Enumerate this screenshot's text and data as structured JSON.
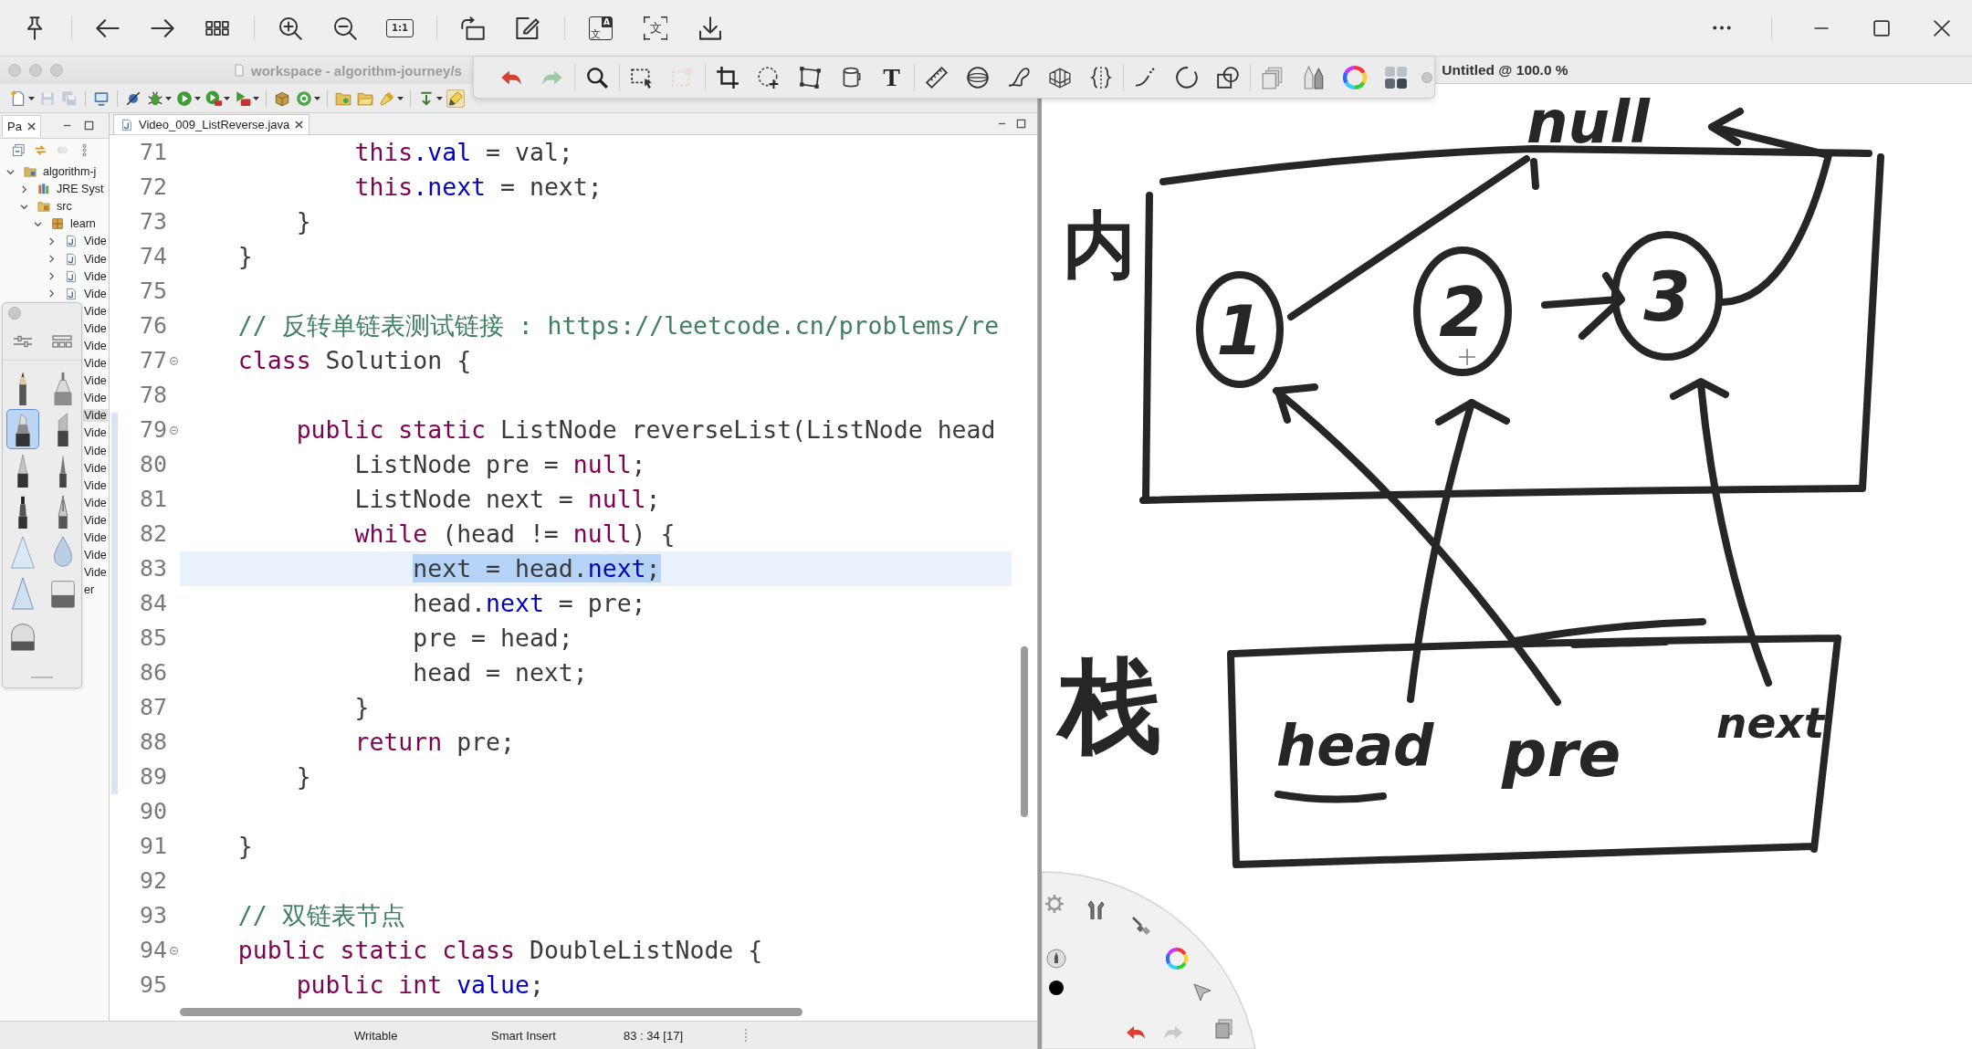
{
  "viewer": {
    "toolbar": [
      [
        {
          "kind": "pin"
        }
      ],
      [
        {
          "kind": "back"
        },
        {
          "kind": "forward"
        },
        {
          "kind": "thumbnails"
        }
      ],
      [
        {
          "kind": "zoom-in"
        },
        {
          "kind": "zoom-out"
        },
        {
          "kind": "actual-size",
          "label": "1:1"
        }
      ],
      [
        {
          "kind": "rotate"
        },
        {
          "kind": "edit"
        }
      ],
      [
        {
          "kind": "translate",
          "label": "文",
          "sublabel": "A"
        },
        {
          "kind": "ocr",
          "label": "文"
        },
        {
          "kind": "download"
        }
      ]
    ],
    "window_controls": [
      [
        {
          "kind": "more"
        }
      ],
      [
        {
          "kind": "minimize"
        },
        {
          "kind": "maximize"
        },
        {
          "kind": "close"
        }
      ]
    ]
  },
  "eclipse": {
    "title": "workspace - algorithm-journey/s",
    "toolbar": [
      [
        {
          "kind": "new",
          "dropdown": true,
          "disabled": false,
          "pressed": false
        },
        {
          "kind": "save",
          "dropdown": false,
          "disabled": true,
          "pressed": false
        },
        {
          "kind": "save-all",
          "dropdown": false,
          "disabled": true,
          "pressed": false
        }
      ],
      [
        {
          "kind": "console",
          "dropdown": false,
          "disabled": false,
          "pressed": false
        }
      ],
      [
        {
          "kind": "skip-breakpoints",
          "dropdown": false,
          "disabled": false,
          "pressed": false
        },
        {
          "kind": "debug",
          "dropdown": true,
          "disabled": false,
          "pressed": false
        },
        {
          "kind": "run",
          "dropdown": true,
          "disabled": false,
          "pressed": false
        },
        {
          "kind": "coverage",
          "dropdown": true,
          "disabled": false,
          "pressed": false
        },
        {
          "kind": "external-tools",
          "dropdown": true,
          "disabled": false,
          "pressed": false
        }
      ],
      [
        {
          "kind": "new-package",
          "dropdown": false,
          "disabled": false,
          "pressed": false
        },
        {
          "kind": "new-class",
          "dropdown": true,
          "disabled": false,
          "pressed": false
        }
      ],
      [
        {
          "kind": "open-type",
          "dropdown": false,
          "disabled": false,
          "pressed": false
        },
        {
          "kind": "open-task",
          "dropdown": false,
          "disabled": false,
          "pressed": false
        },
        {
          "kind": "search",
          "dropdown": true,
          "disabled": false,
          "pressed": false
        }
      ],
      [
        {
          "kind": "annotation",
          "dropdown": true,
          "disabled": false,
          "pressed": false
        },
        {
          "kind": "highlight",
          "dropdown": false,
          "disabled": false,
          "pressed": true
        }
      ]
    ],
    "package_explorer": {
      "tab": "Pa",
      "tree": [
        {
          "label": "algorithm-j",
          "kind": "project",
          "expanded": true,
          "selected": false,
          "children": [
            {
              "label": "JRE Syst",
              "kind": "library",
              "expanded": false,
              "selected": false
            },
            {
              "label": "src",
              "kind": "source-folder",
              "expanded": true,
              "selected": false,
              "children": [
                {
                  "label": "learn",
                  "kind": "package",
                  "expanded": true,
                  "selected": false,
                  "children": [
                    {
                      "label": "Vide",
                      "kind": "java-file",
                      "expanded": false,
                      "selected": false
                    },
                    {
                      "label": "Vide",
                      "kind": "java-file",
                      "expanded": false,
                      "selected": false
                    },
                    {
                      "label": "Vide",
                      "kind": "java-file",
                      "expanded": false,
                      "selected": false
                    },
                    {
                      "label": "Vide",
                      "kind": "java-file",
                      "expanded": false,
                      "selected": false
                    },
                    {
                      "label": "Vide",
                      "selected": false
                    },
                    {
                      "label": "Vide",
                      "selected": false
                    },
                    {
                      "label": "Vide",
                      "selected": false
                    },
                    {
                      "label": "Vide",
                      "selected": false
                    },
                    {
                      "label": "Vide",
                      "selected": false
                    },
                    {
                      "label": "Vide",
                      "selected": false
                    },
                    {
                      "label": "Vide",
                      "selected": true
                    },
                    {
                      "label": "Vide",
                      "selected": false
                    },
                    {
                      "label": "Vide",
                      "selected": false
                    },
                    {
                      "label": "Vide",
                      "selected": false
                    },
                    {
                      "label": "Vide",
                      "selected": false
                    },
                    {
                      "label": "Vide",
                      "selected": false
                    },
                    {
                      "label": "Vide",
                      "selected": false
                    },
                    {
                      "label": "Vide",
                      "selected": false
                    },
                    {
                      "label": "Vide",
                      "selected": false
                    },
                    {
                      "label": "Vide",
                      "selected": false
                    },
                    {
                      "label": "er",
                      "selected": false
                    }
                  ]
                }
              ]
            }
          ]
        }
      ]
    },
    "editor": {
      "tab": "Video_009_ListReverse.java",
      "lines": [
        {
          "number": "71",
          "current": false,
          "selected": false,
          "collapsible": false,
          "in_range": false,
          "tokens": [
            {
              "kind": "keyword",
              "text": "            this"
            },
            {
              "kind": "field",
              "text": ".val"
            },
            {
              "kind": "plain",
              "text": " = val;"
            }
          ]
        },
        {
          "number": "72",
          "current": false,
          "selected": false,
          "collapsible": false,
          "in_range": false,
          "tokens": [
            {
              "kind": "keyword",
              "text": "            this"
            },
            {
              "kind": "field",
              "text": ".next"
            },
            {
              "kind": "plain",
              "text": " = next;"
            }
          ]
        },
        {
          "number": "73",
          "current": false,
          "selected": false,
          "collapsible": false,
          "in_range": false,
          "tokens": [
            {
              "kind": "plain",
              "text": "        }"
            }
          ]
        },
        {
          "number": "74",
          "current": false,
          "selected": false,
          "collapsible": false,
          "in_range": false,
          "tokens": [
            {
              "kind": "plain",
              "text": "    }"
            }
          ]
        },
        {
          "number": "75",
          "collapsible": false,
          "in_range": false
        },
        {
          "number": "76",
          "current": false,
          "selected": false,
          "collapsible": false,
          "in_range": false,
          "tokens": [
            {
              "kind": "comment",
              "text": "    // 反转单链表测试链接 : https://leetcode.cn/problems/re"
            }
          ]
        },
        {
          "number": "77",
          "current": false,
          "selected": false,
          "collapsible": true,
          "in_range": false,
          "tokens": [
            {
              "kind": "keyword",
              "text": "    class"
            },
            {
              "kind": "plain",
              "text": " Solution {"
            }
          ]
        },
        {
          "number": "78",
          "collapsible": false,
          "in_range": false
        },
        {
          "number": "79",
          "current": false,
          "selected": false,
          "collapsible": true,
          "in_range": true,
          "tokens": [
            {
              "kind": "keyword",
              "text": "        public"
            },
            {
              "kind": "keyword",
              "text": " static"
            },
            {
              "kind": "plain",
              "text": " ListNode reverseList(ListNode head"
            }
          ]
        },
        {
          "number": "80",
          "current": false,
          "selected": false,
          "collapsible": false,
          "in_range": true,
          "tokens": [
            {
              "kind": "plain",
              "text": "            ListNode pre = "
            },
            {
              "kind": "keyword",
              "text": "null"
            },
            {
              "kind": "plain",
              "text": ";"
            }
          ]
        },
        {
          "number": "81",
          "current": false,
          "selected": false,
          "collapsible": false,
          "in_range": true,
          "tokens": [
            {
              "kind": "plain",
              "text": "            ListNode next = "
            },
            {
              "kind": "keyword",
              "text": "null"
            },
            {
              "kind": "plain",
              "text": ";"
            }
          ]
        },
        {
          "number": "82",
          "current": false,
          "selected": false,
          "collapsible": false,
          "in_range": true,
          "tokens": [
            {
              "kind": "keyword",
              "text": "            while"
            },
            {
              "kind": "plain",
              "text": " (head != "
            },
            {
              "kind": "keyword",
              "text": "null"
            },
            {
              "kind": "plain",
              "text": ") {"
            }
          ]
        },
        {
          "number": "83",
          "current": true,
          "selected": true,
          "collapsible": false,
          "in_range": true,
          "tokens": [
            {
              "kind": "plain",
              "text": "                next = head."
            },
            {
              "kind": "field",
              "text": "next"
            },
            {
              "kind": "plain",
              "text": ";"
            }
          ]
        },
        {
          "number": "84",
          "current": false,
          "selected": false,
          "collapsible": false,
          "in_range": true,
          "tokens": [
            {
              "kind": "plain",
              "text": "                head."
            },
            {
              "kind": "field",
              "text": "next"
            },
            {
              "kind": "plain",
              "text": " = pre;"
            }
          ]
        },
        {
          "number": "85",
          "current": false,
          "selected": false,
          "collapsible": false,
          "in_range": true,
          "tokens": [
            {
              "kind": "plain",
              "text": "                pre = head;"
            }
          ]
        },
        {
          "number": "86",
          "current": false,
          "selected": false,
          "collapsible": false,
          "in_range": true,
          "tokens": [
            {
              "kind": "plain",
              "text": "                head = next;"
            }
          ]
        },
        {
          "number": "87",
          "current": false,
          "selected": false,
          "collapsible": false,
          "in_range": true,
          "tokens": [
            {
              "kind": "plain",
              "text": "            }"
            }
          ]
        },
        {
          "number": "88",
          "current": false,
          "selected": false,
          "collapsible": false,
          "in_range": true,
          "tokens": [
            {
              "kind": "keyword",
              "text": "            return"
            },
            {
              "kind": "plain",
              "text": " pre;"
            }
          ]
        },
        {
          "number": "89",
          "current": false,
          "selected": false,
          "collapsible": false,
          "in_range": true,
          "tokens": [
            {
              "kind": "plain",
              "text": "        }"
            }
          ]
        },
        {
          "number": "90",
          "collapsible": false,
          "in_range": false
        },
        {
          "number": "91",
          "current": false,
          "selected": false,
          "collapsible": false,
          "in_range": false,
          "tokens": [
            {
              "kind": "plain",
              "text": "    }"
            }
          ]
        },
        {
          "number": "92",
          "collapsible": false,
          "in_range": false
        },
        {
          "number": "93",
          "current": false,
          "selected": false,
          "collapsible": false,
          "in_range": false,
          "tokens": [
            {
              "kind": "comment",
              "text": "    // 双链表节点"
            }
          ]
        },
        {
          "number": "94",
          "current": false,
          "selected": false,
          "collapsible": true,
          "in_range": false,
          "tokens": [
            {
              "kind": "keyword",
              "text": "    public"
            },
            {
              "kind": "keyword",
              "text": " static"
            },
            {
              "kind": "keyword",
              "text": " class"
            },
            {
              "kind": "plain",
              "text": " DoubleListNode {"
            }
          ]
        },
        {
          "number": "95",
          "current": false,
          "selected": false,
          "collapsible": false,
          "in_range": false,
          "tokens": [
            {
              "kind": "keyword",
              "text": "        public"
            },
            {
              "kind": "keyword",
              "text": " int"
            },
            {
              "kind": "field",
              "text": " value"
            },
            {
              "kind": "plain",
              "text": ";"
            }
          ]
        }
      ]
    },
    "status_bar": [
      "Writable",
      "Smart Insert",
      "83 : 34 [17]"
    ]
  },
  "sketch": {
    "title": "Untitled @ 100.0 %",
    "toolbar": [
      [
        {
          "kind": "undo",
          "disabled": false
        },
        {
          "kind": "redo",
          "disabled": true
        }
      ],
      [
        {
          "kind": "zoom",
          "disabled": false
        }
      ],
      [
        {
          "kind": "rect-select",
          "disabled": false
        },
        {
          "kind": "clear-select",
          "disabled": true
        }
      ],
      [
        {
          "kind": "crop",
          "disabled": false
        },
        {
          "kind": "transform",
          "disabled": false
        },
        {
          "kind": "distort",
          "disabled": false
        },
        {
          "kind": "fill",
          "disabled": false
        },
        {
          "kind": "text",
          "label": "T",
          "disabled": false
        }
      ],
      [
        {
          "kind": "ruler",
          "disabled": false
        },
        {
          "kind": "ellipse-guide",
          "disabled": false
        },
        {
          "kind": "french-curve",
          "disabled": false
        },
        {
          "kind": "perspective",
          "disabled": false
        },
        {
          "kind": "symmetry",
          "disabled": false
        }
      ],
      [
        {
          "kind": "stroke",
          "disabled": false
        },
        {
          "kind": "circle",
          "disabled": false
        },
        {
          "kind": "shapes",
          "disabled": false
        }
      ],
      [
        {
          "kind": "layers",
          "disabled": false
        },
        {
          "kind": "brushes",
          "disabled": false
        },
        {
          "kind": "color-wheel",
          "disabled": false
        },
        {
          "kind": "swatches",
          "disabled": false
        }
      ]
    ],
    "brush_palette": {
      "header": [
        {
          "kind": "adjust"
        },
        {
          "kind": "library"
        }
      ],
      "tools": [
        {
          "kind": "pencil",
          "selected": false
        },
        {
          "kind": "technical-pen",
          "selected": false
        },
        {
          "kind": "marker",
          "selected": true
        },
        {
          "kind": "chisel-marker",
          "selected": false
        },
        {
          "kind": "ballpoint",
          "selected": false
        },
        {
          "kind": "fine-pen",
          "selected": false
        },
        {
          "kind": "felt-pen",
          "selected": false
        },
        {
          "kind": "fountain-pen",
          "selected": false
        },
        {
          "kind": "airbrush",
          "selected": false
        },
        {
          "kind": "blur",
          "selected": false
        },
        {
          "kind": "cone",
          "selected": false
        },
        {
          "kind": "eraser",
          "selected": false
        },
        {
          "kind": "soft-eraser",
          "selected": false
        }
      ]
    },
    "diagram": {
      "null_label": "null",
      "regions": [
        {
          "label": "内"
        },
        {
          "label": "栈"
        }
      ],
      "nodes": [
        {
          "label": "1"
        },
        {
          "label": "2"
        },
        {
          "label": "3"
        }
      ],
      "pointers": [
        {
          "label": "head",
          "underlined": true
        },
        {
          "label": "pre",
          "underlined": false
        },
        {
          "label": "next",
          "underlined": false
        }
      ]
    },
    "radial_menu": [
      {
        "kind": "settings"
      },
      {
        "kind": "figure"
      },
      {
        "kind": "brush"
      },
      {
        "kind": "color-wheel"
      },
      {
        "kind": "brush-size"
      },
      {
        "kind": "current-color"
      },
      {
        "kind": "select-arrow"
      },
      {
        "kind": "undo"
      },
      {
        "kind": "redo"
      },
      {
        "kind": "layers"
      }
    ]
  }
}
